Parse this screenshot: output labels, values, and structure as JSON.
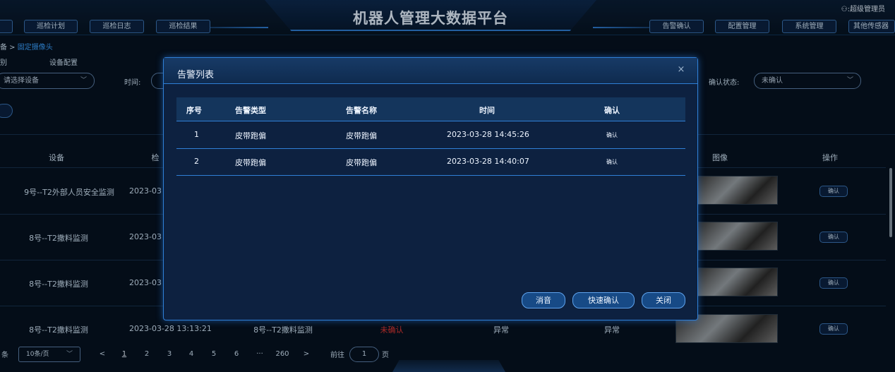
{
  "app": {
    "title": "机器人管理大数据平台",
    "user": "超级管理员"
  },
  "nav": {
    "left": [
      "巡检计划",
      "巡检日志",
      "巡检结果"
    ],
    "right": [
      "告警确认",
      "配置管理",
      "系统管理",
      "其他传感器"
    ]
  },
  "breadcrumb": {
    "prefix": "备 >",
    "current": "固定摄像头"
  },
  "tabs": {
    "first": "别",
    "second": "设备配置"
  },
  "filters": {
    "device_placeholder": "请选择设备",
    "time_label": "时间:",
    "confirm_status_label": "确认状态:",
    "confirm_status_value": "未确认"
  },
  "table": {
    "headers": {
      "device": "设备",
      "check_time": "检",
      "image": "图像",
      "action": "操作"
    },
    "rows": [
      {
        "device": "9号--T2外部人员安全监测",
        "time": "2023-03",
        "action": "确认"
      },
      {
        "device": "8号--T2撒料监测",
        "time": "2023-03",
        "action": "确认"
      },
      {
        "device": "8号--T2撒料监测",
        "time": "2023-03",
        "action": "确认"
      },
      {
        "device": "8号--T2撒料监测",
        "time": "2023-03-28 13:13:21",
        "name": "8号--T2撒料监测",
        "status": "未确认",
        "result1": "异常",
        "result2": "异常",
        "action": "确认"
      }
    ]
  },
  "pagination": {
    "total_suffix": "条",
    "page_size": "10条/页",
    "pages": [
      "1",
      "2",
      "3",
      "4",
      "5",
      "6",
      "···",
      "260"
    ],
    "prev": "<",
    "next": ">",
    "goto_label": "前往",
    "goto_value": "1",
    "page_suffix": "页"
  },
  "modal": {
    "title": "告警列表",
    "close": "×",
    "headers": [
      "序号",
      "告警类型",
      "告警名称",
      "时间",
      "确认"
    ],
    "rows": [
      {
        "index": "1",
        "type": "皮带跑偏",
        "name": "皮带跑偏",
        "time": "2023-03-28 14:45:26",
        "confirm": "确认"
      },
      {
        "index": "2",
        "type": "皮带跑偏",
        "name": "皮带跑偏",
        "time": "2023-03-28 14:40:07",
        "confirm": "确认"
      }
    ],
    "buttons": {
      "mute": "消音",
      "quick_confirm": "快速确认",
      "close": "关闭"
    }
  },
  "colors": {
    "accent": "#2f7fd6",
    "background": "#061220",
    "alert": "#e53935"
  }
}
